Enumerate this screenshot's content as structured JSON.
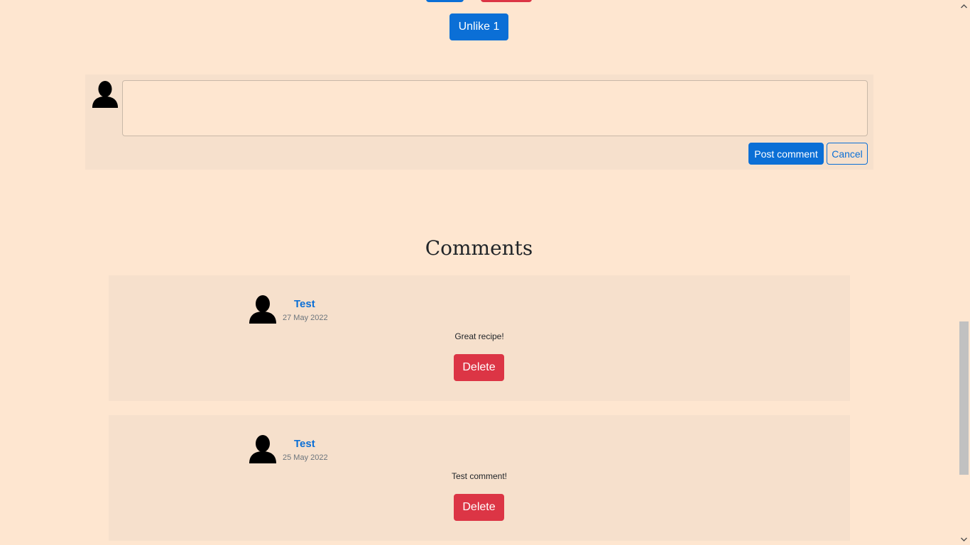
{
  "like_section": {
    "unlike_label": "Unlike 1"
  },
  "comment_form": {
    "textarea_value": "",
    "post_label": "Post comment",
    "cancel_label": "Cancel"
  },
  "comments": {
    "heading": "Comments",
    "items": [
      {
        "author": "Test",
        "date": "27 May 2022",
        "text": "Great recipe!",
        "delete_label": "Delete"
      },
      {
        "author": "Test",
        "date": "25 May 2022",
        "text": "Test comment!",
        "delete_label": "Delete"
      }
    ]
  },
  "colors": {
    "page_background": "#fee6d0",
    "card_background": "#f6e0cc",
    "primary": "#0b6fd6",
    "danger": "#dc3545"
  },
  "icons": {
    "avatar": "user-avatar-icon",
    "scroll_up": "chevron-up-icon",
    "scroll_down": "chevron-down-icon"
  }
}
